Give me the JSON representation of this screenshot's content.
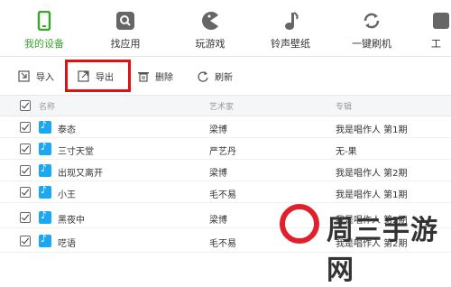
{
  "nav": [
    {
      "label": "我的设备",
      "icon": "phone-icon",
      "active": true
    },
    {
      "label": "找应用",
      "icon": "app-search-icon"
    },
    {
      "label": "玩游戏",
      "icon": "pacman-icon"
    },
    {
      "label": "铃声壁纸",
      "icon": "music-note-icon"
    },
    {
      "label": "一键刷机",
      "icon": "refresh-icon"
    },
    {
      "label": "工",
      "icon": "tools-icon"
    }
  ],
  "toolbar": {
    "import_label": "导入",
    "export_label": "导出",
    "delete_label": "删除",
    "refresh_label": "刷新"
  },
  "table": {
    "headers": {
      "name": "名称",
      "artist": "艺术家",
      "album": "专辑"
    },
    "rows": [
      {
        "name": "泰态",
        "artist": "梁博",
        "album": "我是唱作人 第1期"
      },
      {
        "name": "三寸天堂",
        "artist": "严艺丹",
        "album": "无-果"
      },
      {
        "name": "出现又离开",
        "artist": "梁博",
        "album": "我是唱作人 第2期"
      },
      {
        "name": "小王",
        "artist": "毛不易",
        "album": "我是唱作人 第1期"
      },
      {
        "name": "黑夜中",
        "artist": "梁博",
        "album": "我是唱作人 第2期"
      },
      {
        "name": "呓语",
        "artist": "毛不易",
        "album": "我是唱作人 第2期"
      }
    ]
  },
  "watermark": {
    "text": "周三手游网"
  },
  "colors": {
    "active": "#3aa72e",
    "highlight": "#e01010",
    "note": "#1ba8f0"
  }
}
